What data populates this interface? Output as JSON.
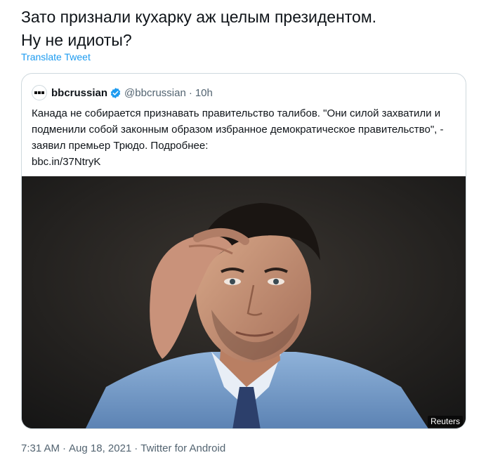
{
  "tweet": {
    "text_line1": "Зато признали кухарку аж целым президентом.",
    "text_line2": "Ну не идиоты?",
    "translate_label": "Translate Tweet"
  },
  "quoted_tweet": {
    "display_name": "bbcrussian",
    "handle": "@bbcrussian",
    "separator": "·",
    "time": "10h",
    "body": "Канада не собирается признавать правительство талибов. \"Они силой захватили и подменили собой законным образом избранное демократическое правительство\", - заявил премьер Трюдо. Подробнее:",
    "link": "bbc.in/37NtryK",
    "image_credit": "Reuters",
    "avatar_icon": "bbc-news-logo-icon",
    "verified_icon": "verified-badge-icon",
    "verified_color": "#1d9bf0"
  },
  "meta": {
    "time": "7:31 AM",
    "separator1": "·",
    "date": "Aug 18, 2021",
    "separator2": "·",
    "source": "Twitter for Android"
  },
  "colors": {
    "link": "#1d9bf0",
    "secondary_text": "#536471",
    "border": "#cfd9de"
  }
}
